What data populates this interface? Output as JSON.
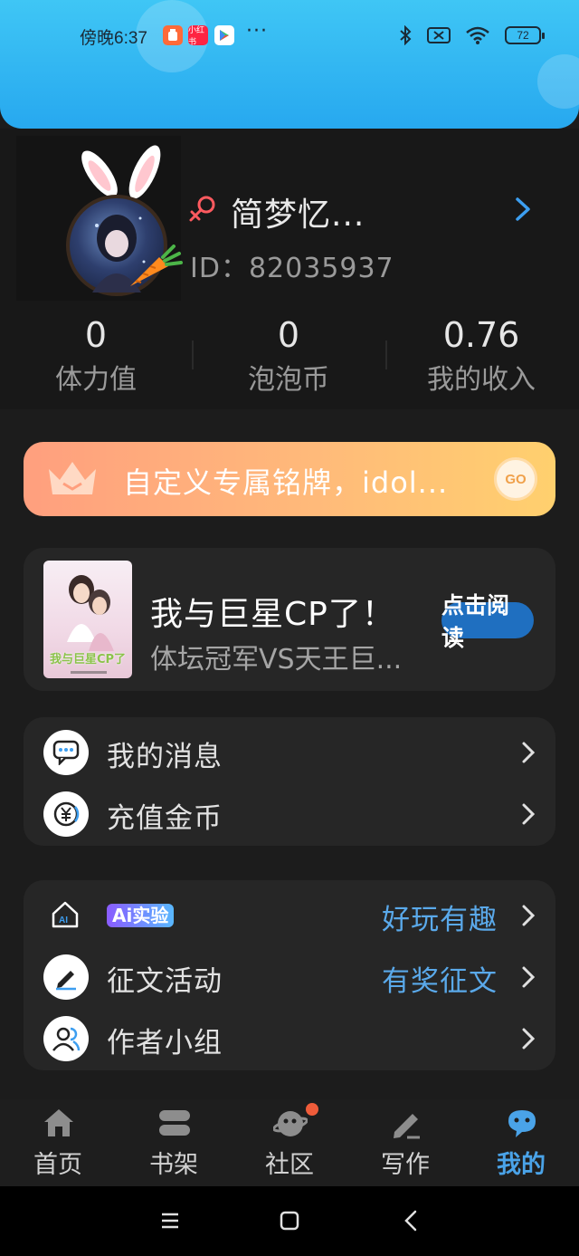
{
  "status_bar": {
    "time": "傍晚6:37",
    "app_badge_label": "小红书",
    "dots": "···",
    "battery": "72"
  },
  "profile": {
    "username": "简梦忆...",
    "user_id": "ID：82035937",
    "stats": [
      {
        "value": "0",
        "label": "体力值"
      },
      {
        "value": "0",
        "label": "泡泡币"
      },
      {
        "value": "0.76",
        "label": "我的收入"
      }
    ]
  },
  "nameplate": {
    "text": "自定义专属铭牌，idol...",
    "go_label": "GO"
  },
  "book": {
    "title": "我与巨星CP了！",
    "subtitle": "体坛冠军VS天王巨...",
    "read_label": "点击阅读",
    "cover_title": "我与巨星CP了"
  },
  "menu_group_1": [
    {
      "label": "我的消息",
      "icon": "message-icon"
    },
    {
      "label": "充值金币",
      "icon": "coin-icon"
    }
  ],
  "menu_group_2": {
    "ai_label": "Ai实验",
    "ai_extra": "好玩有趣",
    "items": [
      {
        "label": "征文活动",
        "extra": "有奖征文",
        "icon": "pen-icon"
      },
      {
        "label": "作者小组",
        "extra": "",
        "icon": "group-icon"
      }
    ]
  },
  "bottom_nav": [
    {
      "label": "首页",
      "icon": "home-icon"
    },
    {
      "label": "书架",
      "icon": "bookshelf-icon"
    },
    {
      "label": "社区",
      "icon": "community-icon"
    },
    {
      "label": "写作",
      "icon": "write-icon"
    },
    {
      "label": "我的",
      "icon": "me-icon",
      "active": true
    }
  ],
  "colors": {
    "header": "#27a8ef",
    "accent": "#4aa3e8",
    "background": "#1c1c1c",
    "card": "#262626"
  }
}
